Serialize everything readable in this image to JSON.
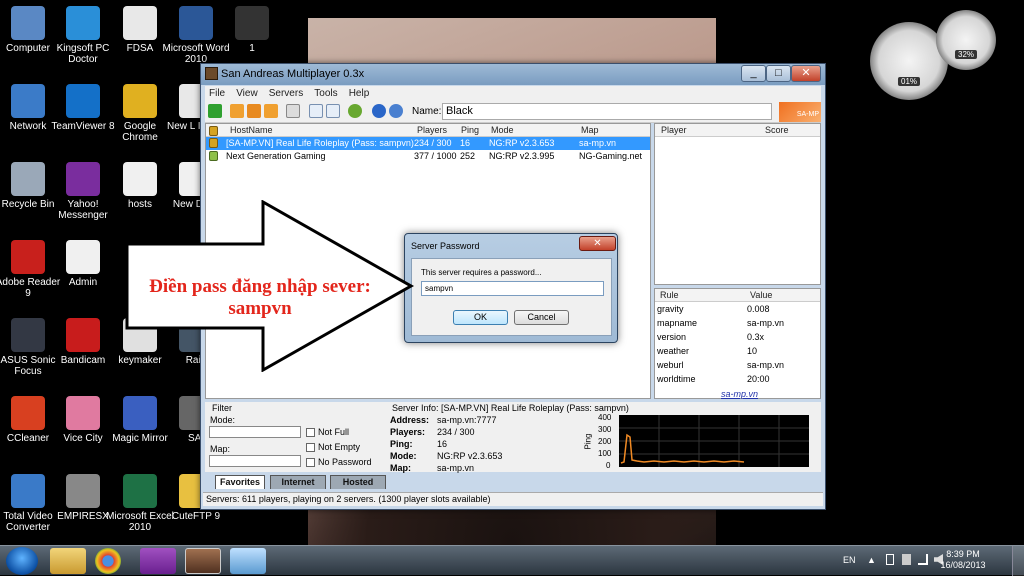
{
  "desktop_icons": [
    {
      "label": "Computer",
      "icon": "computer-icon",
      "color": "#5a88c4"
    },
    {
      "label": "Kingsoft PC Doctor",
      "icon": "shield-icon",
      "color": "#2a8fd8"
    },
    {
      "label": "FDSA",
      "icon": "document-icon",
      "color": "#e8e8e8"
    },
    {
      "label": "Microsoft Word 2010",
      "icon": "word-icon",
      "color": "#2b5797"
    },
    {
      "label": "1",
      "icon": "image-icon",
      "color": "#333333"
    },
    {
      "label": "Network",
      "icon": "network-icon",
      "color": "#3b7bc8"
    },
    {
      "label": "TeamViewer 8",
      "icon": "teamviewer-icon",
      "color": "#1470c8"
    },
    {
      "label": "Google Chrome",
      "icon": "chrome-icon",
      "color": "#e0b020"
    },
    {
      "label": "New L Ibiza -",
      "icon": "document-icon",
      "color": "#e8e8e8"
    },
    {
      "label": "Recycle Bin",
      "icon": "recycle-bin-icon",
      "color": "#9aa8b8"
    },
    {
      "label": "Yahoo! Messenger",
      "icon": "yahoo-icon",
      "color": "#7a2d9e"
    },
    {
      "label": "hosts",
      "icon": "document-icon",
      "color": "#f0f0f0"
    },
    {
      "label": "New Docu",
      "icon": "document-icon",
      "color": "#f0f0f0"
    },
    {
      "label": "Adobe Reader 9",
      "icon": "pdf-icon",
      "color": "#c8201c"
    },
    {
      "label": "Admin",
      "icon": "document-icon",
      "color": "#f0f0f0"
    },
    {
      "label": "ASUS Sonic Focus",
      "icon": "asus-icon",
      "color": "#333844"
    },
    {
      "label": "Bandicam",
      "icon": "record-icon",
      "color": "#c81c1c"
    },
    {
      "label": "keymaker",
      "icon": "keymaker-icon",
      "color": "#e0e0e0"
    },
    {
      "label": "Raid",
      "icon": "raid-icon",
      "color": "#445566"
    },
    {
      "label": "CCleaner",
      "icon": "ccleaner-icon",
      "color": "#d84020"
    },
    {
      "label": "Vice City",
      "icon": "game-icon",
      "color": "#e07aa0"
    },
    {
      "label": "Magic Mirror",
      "icon": "mirror-icon",
      "color": "#3a5fc0"
    },
    {
      "label": "SAI",
      "icon": "sai-icon",
      "color": "#666666"
    },
    {
      "label": "Total Video Converter",
      "icon": "video-icon",
      "color": "#3a7ac8"
    },
    {
      "label": "EMPIRESX",
      "icon": "helmet-icon",
      "color": "#888888"
    },
    {
      "label": "Microsoft Excel 2010",
      "icon": "excel-icon",
      "color": "#1e7145"
    },
    {
      "label": "CuteFTP 9",
      "icon": "ftp-icon",
      "color": "#e8c040"
    }
  ],
  "gadget": {
    "cpu": "01%",
    "ram": "32%"
  },
  "window": {
    "title": "San Andreas Multiplayer 0.3x",
    "min": "_",
    "max": "□",
    "close": "✕",
    "menu": [
      "File",
      "View",
      "Servers",
      "Tools",
      "Help"
    ],
    "name_label": "Name:",
    "name_value": "Black",
    "logo": "SA-MP",
    "columns": [
      "HostName",
      "Players",
      "Ping",
      "Mode",
      "Map"
    ],
    "servers": [
      {
        "host": "[SA-MP.VN] Real Life Roleplay (Pass: sampvn)",
        "players": "234 / 300",
        "ping": "16",
        "mode": "NG:RP v2.3.653",
        "map": "sa-mp.vn",
        "selected": true
      },
      {
        "host": "Next Generation Gaming",
        "players": "377 / 1000",
        "ping": "252",
        "mode": "NG:RP v2.3.995",
        "map": "NG-Gaming.net",
        "selected": false
      }
    ],
    "player_cols": [
      "Player",
      "Score"
    ],
    "rule_cols": [
      "Rule",
      "Value"
    ],
    "rules": [
      {
        "rule": "gravity",
        "value": "0.008"
      },
      {
        "rule": "mapname",
        "value": "sa-mp.vn"
      },
      {
        "rule": "version",
        "value": "0.3x"
      },
      {
        "rule": "weather",
        "value": "10"
      },
      {
        "rule": "weburl",
        "value": "sa-mp.vn"
      },
      {
        "rule": "worldtime",
        "value": "20:00"
      }
    ],
    "weblink": "sa-mp.vn",
    "filter": {
      "title": "Filter",
      "mode_label": "Mode:",
      "map_label": "Map:",
      "not_full": "Not Full",
      "not_empty": "Not Empty",
      "no_password": "No Password"
    },
    "info": {
      "title": "Server Info: [SA-MP.VN] Real Life Roleplay (Pass: sampvn)",
      "address_k": "Address:",
      "address": "sa-mp.vn:7777",
      "players_k": "Players:",
      "players": "234 / 300",
      "ping_k": "Ping:",
      "ping": "16",
      "mode_k": "Mode:",
      "mode": "NG:RP v2.3.653",
      "map_k": "Map:",
      "map": "sa-mp.vn",
      "graph_label": "Ping",
      "graph_ticks": [
        "400",
        "300",
        "200",
        "100",
        "0"
      ]
    },
    "tabs": [
      "Favorites",
      "Internet",
      "Hosted"
    ],
    "status": "Servers: 611 players, playing on 2 servers. (1300 player slots available)"
  },
  "dialog": {
    "title": "Server Password",
    "close": "✕",
    "message": "This server requires a password...",
    "password": "sampvn",
    "ok": "OK",
    "cancel": "Cancel"
  },
  "annotation": {
    "line1": "Điền pass đăng nhập sever:",
    "line2": "sampvn"
  },
  "taskbar": {
    "lang": "EN",
    "time": "8:39 PM",
    "date": "16/08/2013"
  }
}
